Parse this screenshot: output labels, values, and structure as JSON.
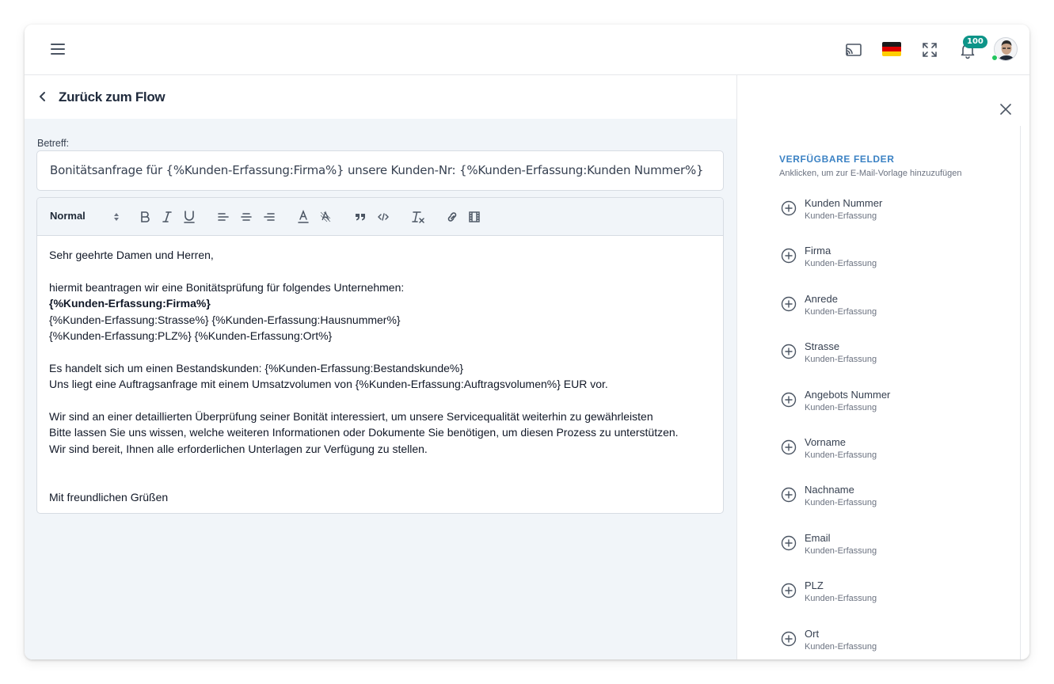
{
  "topbar": {
    "menu_icon": "hamburger-menu-icon",
    "cast_icon": "cast-icon",
    "language_flag": "germany-flag",
    "fullscreen_icon": "fullscreen-icon",
    "notifications_icon": "bell-icon",
    "notification_count": "100",
    "avatar_status": "online"
  },
  "back": {
    "label": "Zurück zum Flow"
  },
  "subject": {
    "label": "Betreff:",
    "value": "Bonitätsanfrage für {%Kunden-Erfassung:Firma%} unsere Kunden-Nr: {%Kunden-Erfassung:Kunden Nummer%}"
  },
  "toolbar": {
    "format_value": "Normal",
    "buttons": [
      "bold",
      "italic",
      "underline",
      "align-left",
      "align-center",
      "align-right",
      "text-color",
      "background-color",
      "blockquote",
      "code",
      "clear-formatting",
      "link",
      "video"
    ]
  },
  "body": {
    "line1": "Sehr geehrte Damen und Herren,",
    "line2": "",
    "line3": "hiermit beantragen wir eine Bonitätsprüfung für folgendes Unternehmen:",
    "line4": "{%Kunden-Erfassung:Firma%}",
    "line5": "{%Kunden-Erfassung:Strasse%} {%Kunden-Erfassung:Hausnummer%}",
    "line6": "{%Kunden-Erfassung:PLZ%} {%Kunden-Erfassung:Ort%}",
    "line7": "",
    "line8": "Es handelt sich um einen Bestandskunden: {%Kunden-Erfassung:Bestandskunde%}",
    "line9": "Uns liegt eine Auftragsanfrage mit einem Umsatzvolumen von {%Kunden-Erfassung:Auftragsvolumen%} EUR vor.",
    "line10": "",
    "line11": "Wir sind an einer detaillierten Überprüfung seiner Bonität interessiert, um unsere Servicequalität weiterhin zu gewährleisten",
    "line12": "Bitte lassen Sie uns wissen, welche weiteren Informationen oder Dokumente Sie benötigen, um diesen Prozess zu unterstützen.",
    "line13": "Wir sind bereit, Ihnen alle erforderlichen Unterlagen zur Verfügung zu stellen.",
    "line14": "",
    "line15": "",
    "line16": "Mit freundlichen Grüßen"
  },
  "panel": {
    "title": "VERFÜGBARE FELDER",
    "hint": "Anklicken, um zur E-Mail-Vorlage hinzuzufügen",
    "fields": [
      {
        "name": "Kunden Nummer",
        "source": "Kunden-Erfassung"
      },
      {
        "name": "Firma",
        "source": "Kunden-Erfassung"
      },
      {
        "name": "Anrede",
        "source": "Kunden-Erfassung"
      },
      {
        "name": "Strasse",
        "source": "Kunden-Erfassung"
      },
      {
        "name": "Angebots Nummer",
        "source": "Kunden-Erfassung"
      },
      {
        "name": "Vorname",
        "source": "Kunden-Erfassung"
      },
      {
        "name": "Nachname",
        "source": "Kunden-Erfassung"
      },
      {
        "name": "Email",
        "source": "Kunden-Erfassung"
      },
      {
        "name": "PLZ",
        "source": "Kunden-Erfassung"
      },
      {
        "name": "Ort",
        "source": "Kunden-Erfassung"
      }
    ]
  },
  "colors": {
    "accent": "#3b82c4",
    "badge": "#0d9488",
    "online": "#22c55e",
    "pane_bg": "#f1f5f9"
  }
}
